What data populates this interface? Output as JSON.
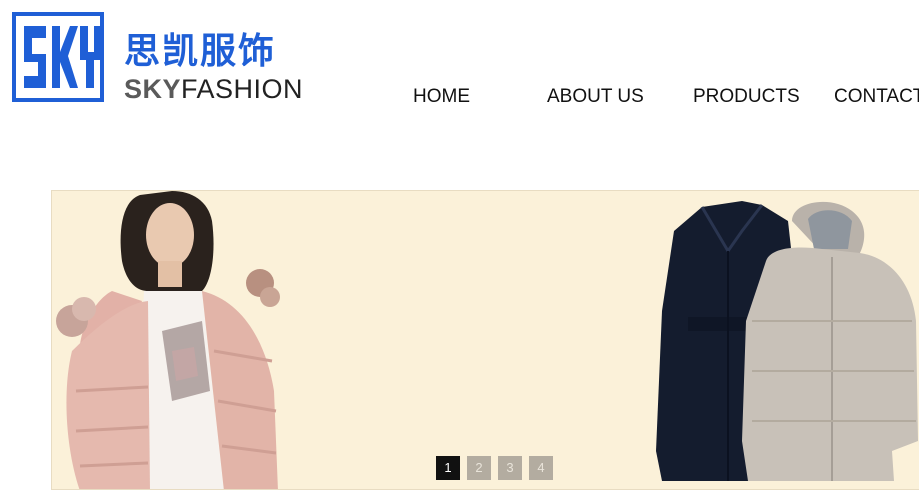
{
  "header": {
    "logo_letters": "SKY",
    "brand_cn": "思凯服饰",
    "brand_en_bold": "SKY",
    "brand_en_light": "FASHION",
    "logo_color": "#1f5fd6"
  },
  "nav": {
    "items": [
      {
        "label": "HOME"
      },
      {
        "label": "ABOUT US"
      },
      {
        "label": "PRODUCTS"
      },
      {
        "label": "CONTACT"
      }
    ]
  },
  "banner": {
    "background_color": "#fbf1d9",
    "slides": [
      {
        "label": "1",
        "active": true
      },
      {
        "label": "2",
        "active": false
      },
      {
        "label": "3",
        "active": false
      },
      {
        "label": "4",
        "active": false
      }
    ]
  }
}
